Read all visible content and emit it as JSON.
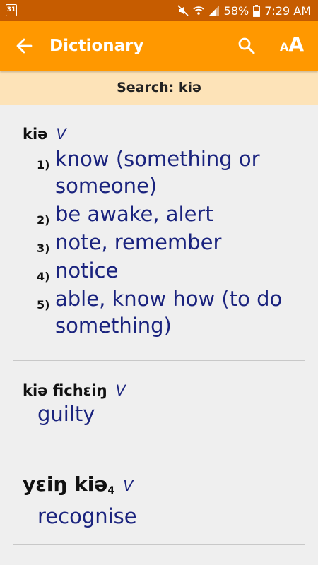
{
  "status": {
    "calendar_day": "31",
    "battery": "58%",
    "time": "7:29 AM"
  },
  "appbar": {
    "title": "Dictionary",
    "font_icon_small": "A",
    "font_icon_big": "A"
  },
  "searchbar": {
    "text": "Search: kiə"
  },
  "entries": [
    {
      "headword": "kiə",
      "pos": "V",
      "senses": [
        {
          "num": "1)",
          "gloss": "know (something or someone)"
        },
        {
          "num": "2)",
          "gloss": "be awake, alert"
        },
        {
          "num": "3)",
          "gloss": "note, remember"
        },
        {
          "num": "4)",
          "gloss": "notice"
        },
        {
          "num": "5)",
          "gloss": "able, know how (to do something)"
        }
      ]
    },
    {
      "headword": "kiə fichɛiŋ",
      "pos": "V",
      "gloss": "guilty"
    },
    {
      "headword": "yɛiŋ kiə",
      "subscript": "4",
      "pos": "V",
      "gloss": "recognise"
    }
  ]
}
